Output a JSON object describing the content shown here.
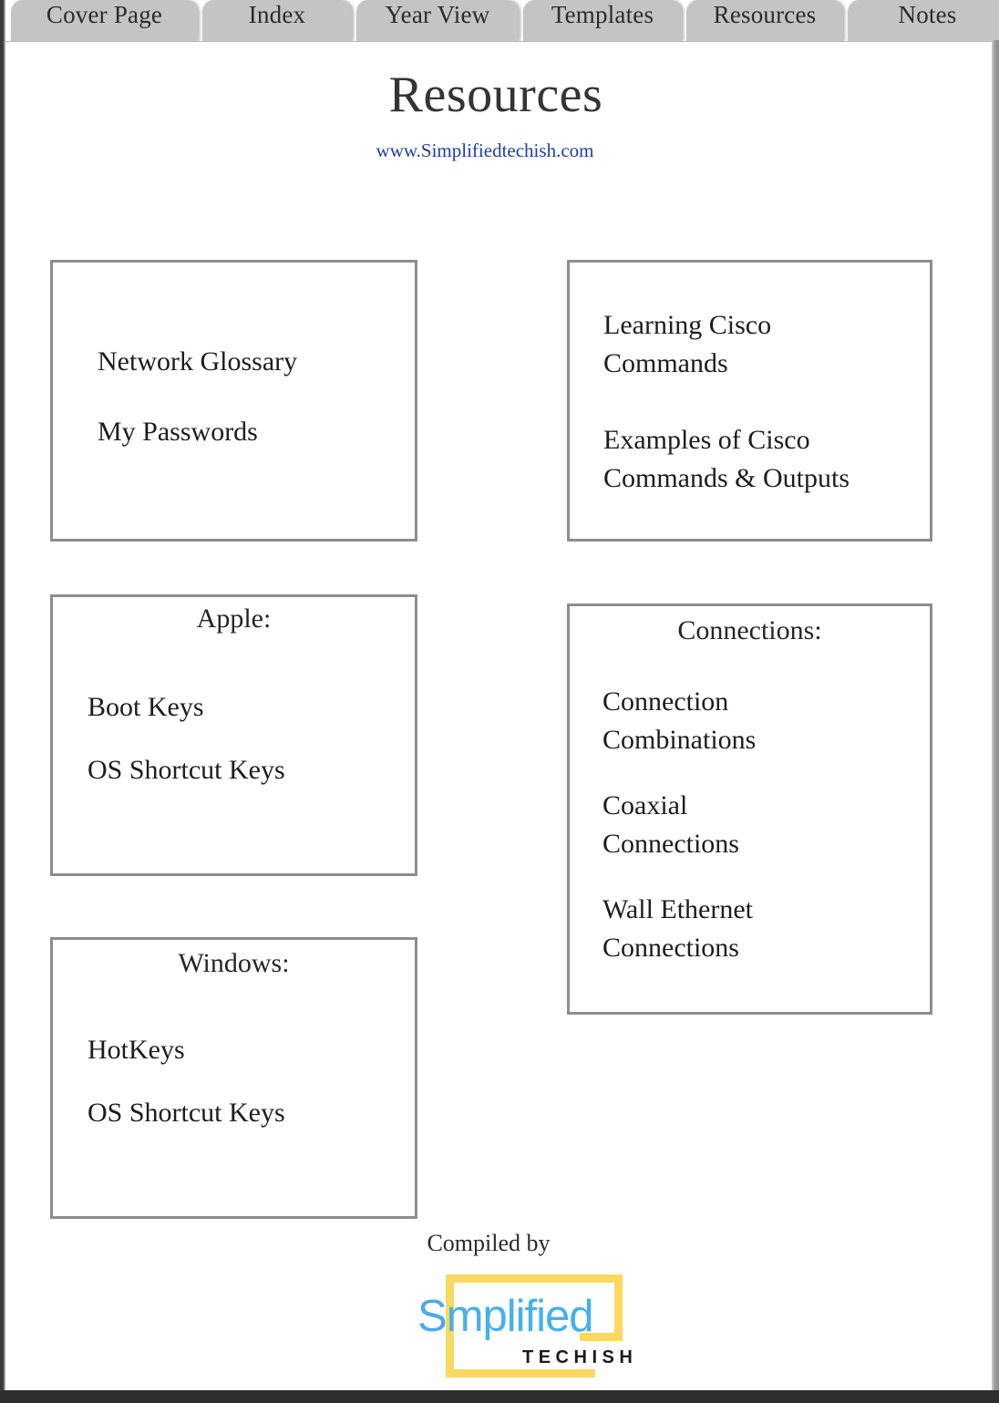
{
  "tabs": [
    {
      "label": "Cover Page",
      "active": false
    },
    {
      "label": "Index",
      "active": false
    },
    {
      "label": "Year View",
      "active": false
    },
    {
      "label": "Templates",
      "active": false
    },
    {
      "label": "Resources",
      "active": true
    },
    {
      "label": "Notes",
      "active": false
    }
  ],
  "header": {
    "title": "Resources",
    "url": "www.Simplifiedtechish.com"
  },
  "boxes": {
    "glossary": {
      "items": [
        "Network Glossary",
        "My Passwords"
      ]
    },
    "cisco": {
      "groups": [
        [
          "Learning Cisco",
          "Commands"
        ],
        [
          "Examples of Cisco",
          "Commands & Outputs"
        ]
      ]
    },
    "apple": {
      "heading": "Apple:",
      "items": [
        "Boot Keys",
        "OS Shortcut Keys"
      ]
    },
    "connections": {
      "heading": "Connections:",
      "groups": [
        [
          "Connection",
          "Combinations"
        ],
        [
          "Coaxial",
          "Connections"
        ],
        [
          "Wall Ethernet",
          "Connections"
        ]
      ]
    },
    "windows": {
      "heading": "Windows:",
      "items": [
        "HotKeys",
        "OS Shortcut Keys"
      ]
    }
  },
  "footer": {
    "compiled_by": "Compiled by",
    "logo": {
      "word_first": "S",
      "word_rest": "mplified",
      "subtitle": "TECHISH",
      "frame_color": "#fbd85f",
      "word_color": "#45b0ec",
      "subtitle_color": "#1b1b1b"
    }
  },
  "colors": {
    "tab_bg": "#c4c4c4",
    "box_border": "#8d8d8d",
    "title_text": "#343434",
    "link_text": "#1f3fa0",
    "page_bg": "#ffffff",
    "edge_dark": "#2e2e2e"
  }
}
